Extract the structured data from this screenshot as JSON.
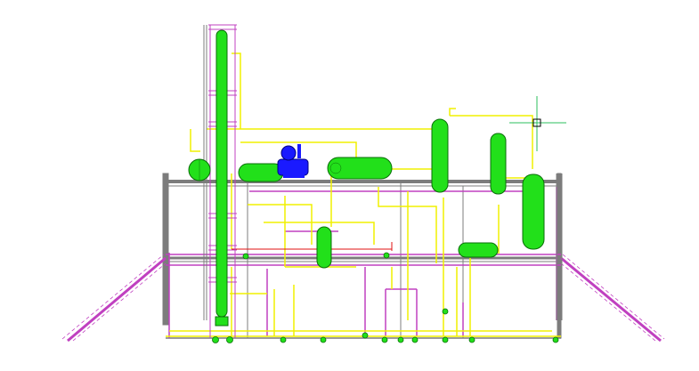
{
  "app": {
    "view": "3D plant model",
    "background_color": "#ffffff"
  },
  "colors": {
    "vessel_green": "#22e01a",
    "vessel_outline": "#0a6e08",
    "pump_blue": "#1a1aff",
    "structure_gray": "#7c7c7c",
    "pipe_yellow": "#f0f000",
    "pipe_magenta": "#c040c0",
    "pipe_red": "#e01010",
    "crosshair_green": "#2bbf5e",
    "pickbox_black": "#000000"
  },
  "equipment": [
    {
      "name": "distillation-column",
      "type": "column"
    },
    {
      "name": "sphere-tank",
      "type": "sphere"
    },
    {
      "name": "horizontal-drum-left",
      "type": "horizontal-vessel"
    },
    {
      "name": "pump-package",
      "type": "pump"
    },
    {
      "name": "horizontal-drum-center",
      "type": "horizontal-vessel"
    },
    {
      "name": "vertical-vessel-tall",
      "type": "vertical-vessel"
    },
    {
      "name": "vertical-vessel-mid",
      "type": "vertical-vessel"
    },
    {
      "name": "vertical-vessel-right",
      "type": "vertical-vessel"
    },
    {
      "name": "vertical-vessel-lower",
      "type": "vertical-vessel"
    },
    {
      "name": "horizontal-drum-lower-right",
      "type": "horizontal-vessel"
    }
  ],
  "cursor": {
    "type": "crosshair-with-pickbox"
  }
}
